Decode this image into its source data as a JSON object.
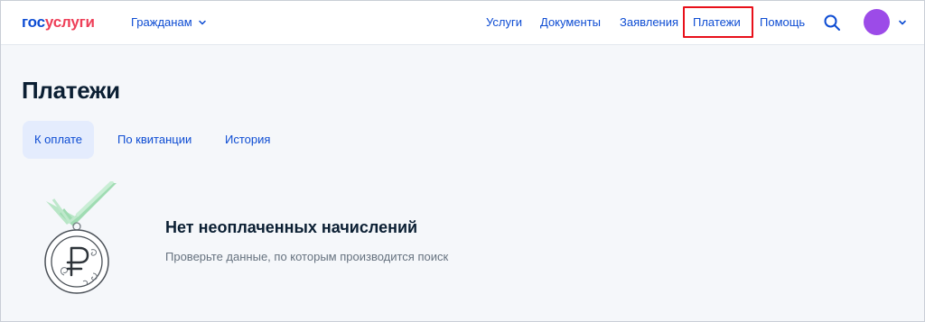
{
  "header": {
    "logo_part1": "гос",
    "logo_part2": "услуги",
    "citizens_menu": "Гражданам",
    "nav": {
      "services": "Услуги",
      "documents": "Документы",
      "applications": "Заявления",
      "payments": "Платежи",
      "help": "Помощь"
    },
    "avatar_color": "#9c4be8"
  },
  "page": {
    "title": "Платежи",
    "tabs": [
      {
        "label": "К оплате",
        "active": true
      },
      {
        "label": "По квитанции",
        "active": false
      },
      {
        "label": "История",
        "active": false
      }
    ],
    "empty_state": {
      "title": "Нет неоплаченных начислений",
      "subtitle": "Проверьте данные, по которым производится поиск"
    }
  },
  "colors": {
    "brand_blue": "#0d4cd3",
    "brand_red": "#ee3f58",
    "highlight": "#e8101a",
    "background": "#f5f7fa",
    "tab_active_bg": "#e4ecfd"
  }
}
